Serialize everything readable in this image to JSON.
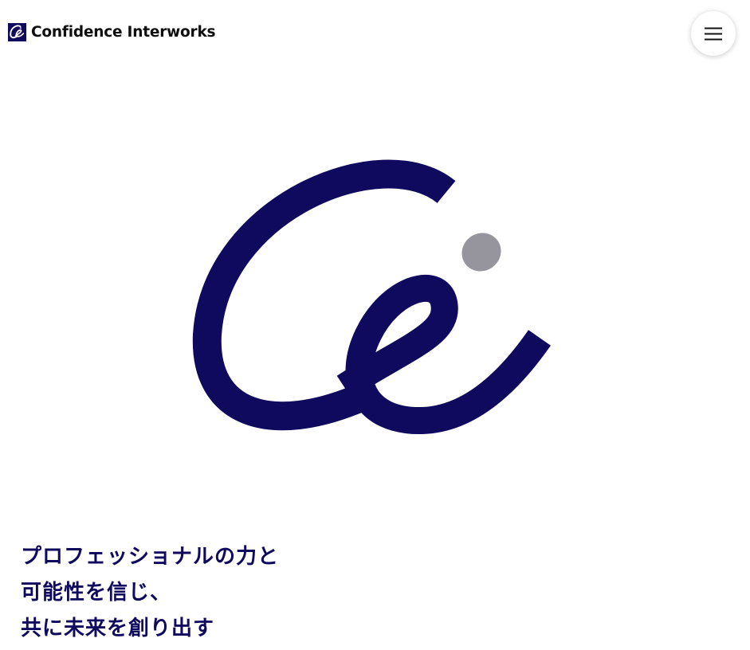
{
  "header": {
    "company_name": "Confidence Interworks",
    "logo_icon": "ce-monogram-icon",
    "menu_icon": "hamburger-menu-icon"
  },
  "hero": {
    "logo_icon": "ce-logo-icon"
  },
  "tagline": {
    "lines": [
      "プロフェッショナルの力と",
      "可能性を信じ、",
      "共に未来を創り出す"
    ]
  },
  "colors": {
    "brand_navy": "#100a5e",
    "dot_gray": "#96959d",
    "text_dark": "#0f0f0f",
    "background": "#ffffff"
  }
}
